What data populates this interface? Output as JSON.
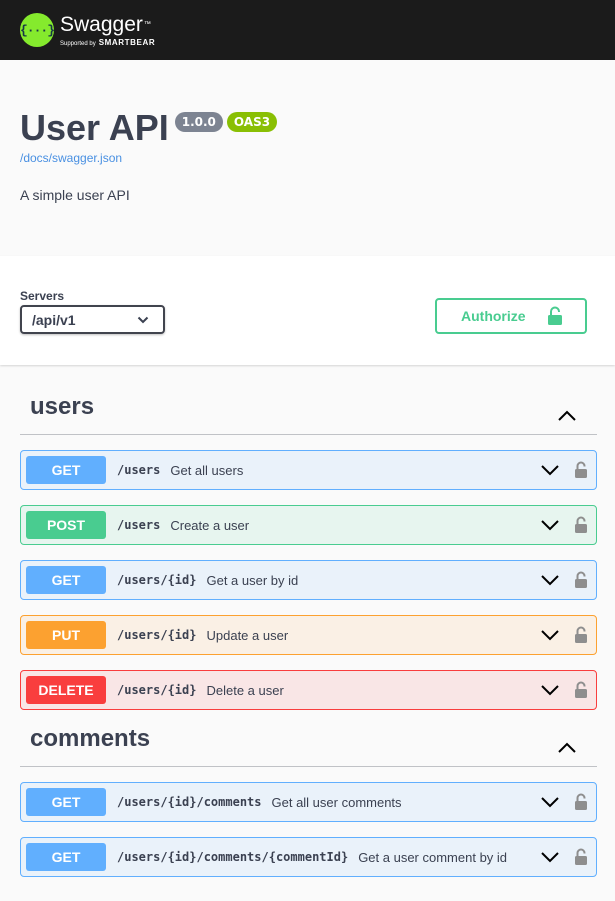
{
  "topbar": {
    "logo_glyph": "{···}",
    "logo_title": "Swagger",
    "logo_tm": "™",
    "logo_supported": "Supported by",
    "logo_brand": "SMARTBEAR"
  },
  "info": {
    "title": "User API",
    "version": "1.0.0",
    "oas": "OAS3",
    "spec_link": "/docs/swagger.json",
    "description": "A simple user API"
  },
  "servers": {
    "label": "Servers",
    "selected": "/api/v1"
  },
  "authorize": {
    "label": "Authorize"
  },
  "tags": [
    {
      "name": "users",
      "operations": [
        {
          "method": "GET",
          "path": "/users",
          "summary": "Get all users"
        },
        {
          "method": "POST",
          "path": "/users",
          "summary": "Create a user"
        },
        {
          "method": "GET",
          "path": "/users/{id}",
          "summary": "Get a user by id"
        },
        {
          "method": "PUT",
          "path": "/users/{id}",
          "summary": "Update a user"
        },
        {
          "method": "DELETE",
          "path": "/users/{id}",
          "summary": "Delete a user"
        }
      ]
    },
    {
      "name": "comments",
      "operations": [
        {
          "method": "GET",
          "path": "/users/{id}/comments",
          "summary": "Get all user comments"
        },
        {
          "method": "GET",
          "path": "/users/{id}/comments/{commentId}",
          "summary": "Get a user comment by id"
        }
      ]
    }
  ],
  "icons": {
    "expand": "chevron-down-icon",
    "collapse": "chevron-up-icon",
    "lock": "lock-icon"
  },
  "colors": {
    "get": "#61affe",
    "post": "#49cc90",
    "put": "#fca130",
    "delete": "#f93e3e",
    "topbar": "#1b1b1b",
    "logo": "#85ea2d"
  }
}
